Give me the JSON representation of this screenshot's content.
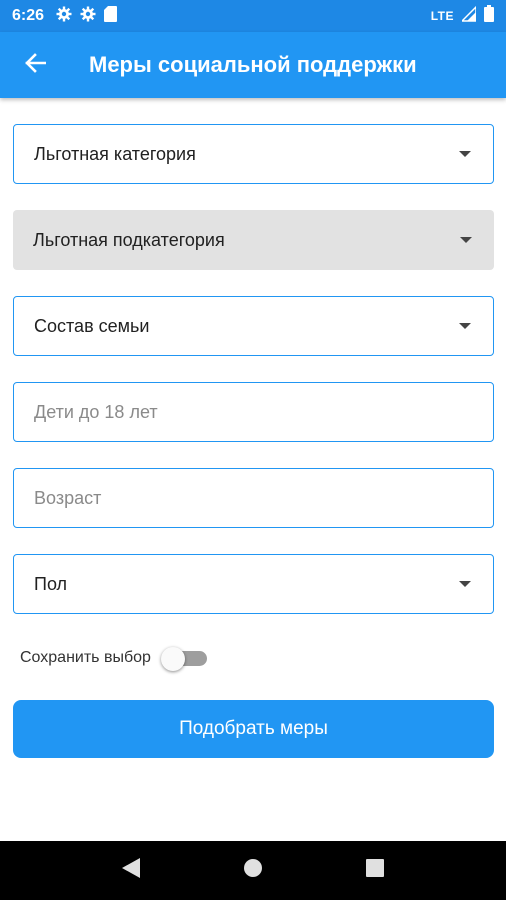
{
  "status_bar": {
    "time": "6:26",
    "left_icons": [
      "settings-icon",
      "settings-icon",
      "sd-card-icon"
    ],
    "network": "LTE",
    "right_icons": [
      "signal-icon",
      "battery-icon"
    ]
  },
  "app_bar": {
    "back_icon": "arrow-left-icon",
    "title": "Меры социальной поддержки",
    "color": "#2196f3"
  },
  "form": {
    "benefit_category": {
      "label": "Льготная категория",
      "type": "dropdown"
    },
    "benefit_subcategory": {
      "label": "Льготная подкатегория",
      "type": "dropdown",
      "disabled": true
    },
    "family_composition": {
      "label": "Состав семьи",
      "type": "dropdown"
    },
    "children_under_18": {
      "placeholder": "Дети до 18 лет",
      "value": ""
    },
    "age": {
      "placeholder": "Возраст",
      "value": ""
    },
    "gender": {
      "label": "Пол",
      "type": "dropdown"
    },
    "save_choice": {
      "label": "Сохранить выбор",
      "checked": false
    },
    "submit_label": "Подобрать меры"
  },
  "nav_bar": {
    "buttons": [
      "back-triangle-icon",
      "home-circle-icon",
      "recents-square-icon"
    ]
  },
  "colors": {
    "accent": "#2196f3",
    "status_bar": "#1e88e5",
    "disabled_field": "#e2e2e2"
  }
}
